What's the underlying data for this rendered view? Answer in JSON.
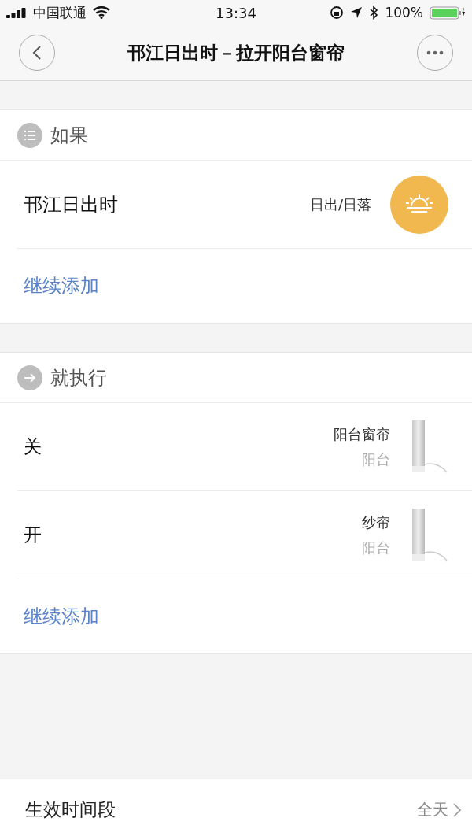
{
  "status_bar": {
    "carrier": "中国联通",
    "time": "13:34",
    "battery": "100%"
  },
  "header": {
    "title": "邗江日出时－拉开阳台窗帘"
  },
  "sections": [
    {
      "kind": "condition",
      "title": "如果",
      "rows": [
        {
          "label": "邗江日出时",
          "name": "日出/日落"
        }
      ],
      "add_label": "继续添加"
    },
    {
      "kind": "action",
      "title": "就执行",
      "rows": [
        {
          "label": "关",
          "name": "阳台窗帘",
          "room": "阳台"
        },
        {
          "label": "开",
          "name": "纱帘",
          "room": "阳台"
        }
      ],
      "add_label": "继续添加"
    }
  ],
  "footer": {
    "label": "生效时间段",
    "value": "全天"
  }
}
